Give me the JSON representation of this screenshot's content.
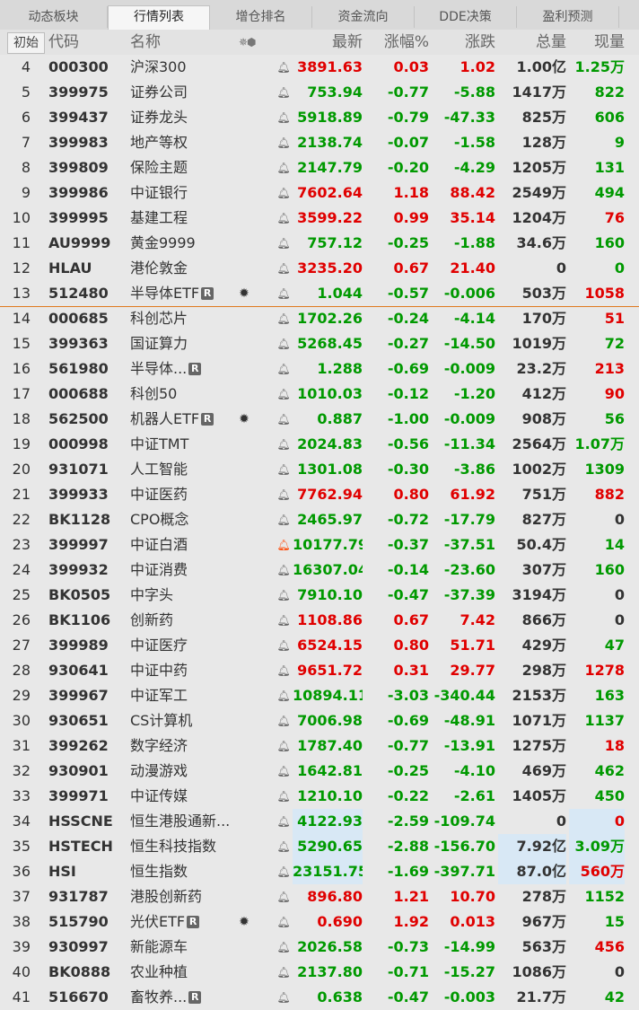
{
  "tabs": [
    {
      "label": "动态板块",
      "active": false
    },
    {
      "label": "行情列表",
      "active": true
    },
    {
      "label": "增仓排名",
      "active": false
    },
    {
      "label": "资金流向",
      "active": false
    },
    {
      "label": "DDE决策",
      "active": false
    },
    {
      "label": "盈利预测",
      "active": false
    }
  ],
  "header": {
    "init": "初始",
    "code": "代码",
    "name": "名称",
    "sort_icons": "✵⬢",
    "price": "最新",
    "pct": "涨幅%",
    "chg": "涨跌",
    "vol": "总量",
    "cur": "现量"
  },
  "colors": {
    "up": "#e00000",
    "down": "#009900",
    "separator": "#e07a20",
    "highlight": "#d8e8f5"
  },
  "rows": [
    {
      "idx": "4",
      "code": "000300",
      "name": "沪深300",
      "price": "3891.63",
      "pct": "0.03",
      "chg": "1.02",
      "vol": "1.00亿",
      "cur": "1.25万",
      "dir": "up",
      "cur_dir": "down"
    },
    {
      "idx": "5",
      "code": "399975",
      "name": "证券公司",
      "price": "753.94",
      "pct": "-0.77",
      "chg": "-5.88",
      "vol": "1417万",
      "cur": "822",
      "dir": "down",
      "cur_dir": "down"
    },
    {
      "idx": "6",
      "code": "399437",
      "name": "证券龙头",
      "price": "5918.89",
      "pct": "-0.79",
      "chg": "-47.33",
      "vol": "825万",
      "cur": "606",
      "dir": "down",
      "cur_dir": "down"
    },
    {
      "idx": "7",
      "code": "399983",
      "name": "地产等权",
      "price": "2138.74",
      "pct": "-0.07",
      "chg": "-1.58",
      "vol": "128万",
      "cur": "9",
      "dir": "down",
      "cur_dir": "down"
    },
    {
      "idx": "8",
      "code": "399809",
      "name": "保险主题",
      "price": "2147.79",
      "pct": "-0.20",
      "chg": "-4.29",
      "vol": "1205万",
      "cur": "131",
      "dir": "down",
      "cur_dir": "down"
    },
    {
      "idx": "9",
      "code": "399986",
      "name": "中证银行",
      "price": "7602.64",
      "pct": "1.18",
      "chg": "88.42",
      "vol": "2549万",
      "cur": "494",
      "dir": "up",
      "cur_dir": "down"
    },
    {
      "idx": "10",
      "code": "399995",
      "name": "基建工程",
      "price": "3599.22",
      "pct": "0.99",
      "chg": "35.14",
      "vol": "1204万",
      "cur": "76",
      "dir": "up",
      "cur_dir": "up"
    },
    {
      "idx": "11",
      "code": "AU9999",
      "name": "黄金9999",
      "price": "757.12",
      "pct": "-0.25",
      "chg": "-1.88",
      "vol": "34.6万",
      "cur": "160",
      "dir": "down",
      "cur_dir": "down"
    },
    {
      "idx": "12",
      "code": "HLAU",
      "name": "港伦敦金",
      "price": "3235.20",
      "pct": "0.67",
      "chg": "21.40",
      "vol": "0",
      "cur": "0",
      "dir": "up",
      "cur_dir": "down"
    },
    {
      "idx": "13",
      "code": "512480",
      "name": "半导体ETF",
      "badge": "R",
      "star": true,
      "price": "1.044",
      "pct": "-0.57",
      "chg": "-0.006",
      "vol": "503万",
      "cur": "1058",
      "dir": "down",
      "cur_dir": "up"
    },
    {
      "idx": "14",
      "code": "000685",
      "name": "科创芯片",
      "price": "1702.26",
      "pct": "-0.24",
      "chg": "-4.14",
      "vol": "170万",
      "cur": "51",
      "dir": "down",
      "cur_dir": "up"
    },
    {
      "idx": "15",
      "code": "399363",
      "name": "国证算力",
      "price": "5268.45",
      "pct": "-0.27",
      "chg": "-14.50",
      "vol": "1019万",
      "cur": "72",
      "dir": "down",
      "cur_dir": "down"
    },
    {
      "idx": "16",
      "code": "561980",
      "name": "半导体...",
      "badge": "R",
      "price": "1.288",
      "pct": "-0.69",
      "chg": "-0.009",
      "vol": "23.2万",
      "cur": "213",
      "dir": "down",
      "cur_dir": "up"
    },
    {
      "idx": "17",
      "code": "000688",
      "name": "科创50",
      "price": "1010.03",
      "pct": "-0.12",
      "chg": "-1.20",
      "vol": "412万",
      "cur": "90",
      "dir": "down",
      "cur_dir": "up"
    },
    {
      "idx": "18",
      "code": "562500",
      "name": "机器人ETF",
      "badge": "R",
      "star": true,
      "price": "0.887",
      "pct": "-1.00",
      "chg": "-0.009",
      "vol": "908万",
      "cur": "56",
      "dir": "down",
      "cur_dir": "down"
    },
    {
      "idx": "19",
      "code": "000998",
      "name": "中证TMT",
      "price": "2024.83",
      "pct": "-0.56",
      "chg": "-11.34",
      "vol": "2564万",
      "cur": "1.07万",
      "dir": "down",
      "cur_dir": "down"
    },
    {
      "idx": "20",
      "code": "931071",
      "name": "人工智能",
      "price": "1301.08",
      "pct": "-0.30",
      "chg": "-3.86",
      "vol": "1002万",
      "cur": "1309",
      "dir": "down",
      "cur_dir": "down"
    },
    {
      "idx": "21",
      "code": "399933",
      "name": "中证医药",
      "price": "7762.94",
      "pct": "0.80",
      "chg": "61.92",
      "vol": "751万",
      "cur": "882",
      "dir": "up",
      "cur_dir": "up"
    },
    {
      "idx": "22",
      "code": "BK1128",
      "name": "CPO概念",
      "price": "2465.97",
      "pct": "-0.72",
      "chg": "-17.79",
      "vol": "827万",
      "cur": "0",
      "dir": "down",
      "cur_dir": "neutral"
    },
    {
      "idx": "23",
      "code": "399997",
      "name": "中证白酒",
      "bell_alert": true,
      "price": "10177.79",
      "pct": "-0.37",
      "chg": "-37.51",
      "vol": "50.4万",
      "cur": "14",
      "dir": "down",
      "cur_dir": "down"
    },
    {
      "idx": "24",
      "code": "399932",
      "name": "中证消费",
      "price": "16307.04",
      "pct": "-0.14",
      "chg": "-23.60",
      "vol": "307万",
      "cur": "160",
      "dir": "down",
      "cur_dir": "down"
    },
    {
      "idx": "25",
      "code": "BK0505",
      "name": "中字头",
      "price": "7910.10",
      "pct": "-0.47",
      "chg": "-37.39",
      "vol": "3194万",
      "cur": "0",
      "dir": "down",
      "cur_dir": "neutral"
    },
    {
      "idx": "26",
      "code": "BK1106",
      "name": "创新药",
      "price": "1108.86",
      "pct": "0.67",
      "chg": "7.42",
      "vol": "866万",
      "cur": "0",
      "dir": "up",
      "cur_dir": "neutral"
    },
    {
      "idx": "27",
      "code": "399989",
      "name": "中证医疗",
      "price": "6524.15",
      "pct": "0.80",
      "chg": "51.71",
      "vol": "429万",
      "cur": "47",
      "dir": "up",
      "cur_dir": "down"
    },
    {
      "idx": "28",
      "code": "930641",
      "name": "中证中药",
      "price": "9651.72",
      "pct": "0.31",
      "chg": "29.77",
      "vol": "298万",
      "cur": "1278",
      "dir": "up",
      "cur_dir": "up"
    },
    {
      "idx": "29",
      "code": "399967",
      "name": "中证军工",
      "price": "10894.11",
      "pct": "-3.03",
      "chg": "-340.44",
      "vol": "2153万",
      "cur": "163",
      "dir": "down",
      "cur_dir": "down"
    },
    {
      "idx": "30",
      "code": "930651",
      "name": "CS计算机",
      "price": "7006.98",
      "pct": "-0.69",
      "chg": "-48.91",
      "vol": "1071万",
      "cur": "1137",
      "dir": "down",
      "cur_dir": "down"
    },
    {
      "idx": "31",
      "code": "399262",
      "name": "数字经济",
      "price": "1787.40",
      "pct": "-0.77",
      "chg": "-13.91",
      "vol": "1275万",
      "cur": "18",
      "dir": "down",
      "cur_dir": "up"
    },
    {
      "idx": "32",
      "code": "930901",
      "name": "动漫游戏",
      "price": "1642.81",
      "pct": "-0.25",
      "chg": "-4.10",
      "vol": "469万",
      "cur": "462",
      "dir": "down",
      "cur_dir": "down"
    },
    {
      "idx": "33",
      "code": "399971",
      "name": "中证传媒",
      "price": "1210.10",
      "pct": "-0.22",
      "chg": "-2.61",
      "vol": "1405万",
      "cur": "450",
      "dir": "down",
      "cur_dir": "down"
    },
    {
      "idx": "34",
      "code": "HSSCNE",
      "name": "恒生港股通新...",
      "price": "4122.93",
      "pct": "-2.59",
      "chg": "-109.74",
      "vol": "0",
      "cur": "0",
      "dir": "down",
      "cur_dir": "up",
      "hl_price": true,
      "hl_cur": true
    },
    {
      "idx": "35",
      "code": "HSTECH",
      "name": "恒生科技指数",
      "price": "5290.65",
      "pct": "-2.88",
      "chg": "-156.70",
      "vol": "7.92亿",
      "cur": "3.09万",
      "dir": "down",
      "cur_dir": "down",
      "hl_price": true,
      "hl_vol": true,
      "hl_cur": true
    },
    {
      "idx": "36",
      "code": "HSI",
      "name": "恒生指数",
      "price": "23151.75",
      "pct": "-1.69",
      "chg": "-397.71",
      "vol": "87.0亿",
      "cur": "560万",
      "dir": "down",
      "cur_dir": "up",
      "hl_price": true,
      "hl_vol": true,
      "hl_cur": true
    },
    {
      "idx": "37",
      "code": "931787",
      "name": "港股创新药",
      "price": "896.80",
      "pct": "1.21",
      "chg": "10.70",
      "vol": "278万",
      "cur": "1152",
      "dir": "up",
      "cur_dir": "down"
    },
    {
      "idx": "38",
      "code": "515790",
      "name": "光伏ETF",
      "badge": "R",
      "star": true,
      "price": "0.690",
      "pct": "1.92",
      "chg": "0.013",
      "vol": "967万",
      "cur": "15",
      "dir": "up",
      "cur_dir": "down"
    },
    {
      "idx": "39",
      "code": "930997",
      "name": "新能源车",
      "price": "2026.58",
      "pct": "-0.73",
      "chg": "-14.99",
      "vol": "563万",
      "cur": "456",
      "dir": "down",
      "cur_dir": "up"
    },
    {
      "idx": "40",
      "code": "BK0888",
      "name": "农业种植",
      "price": "2137.80",
      "pct": "-0.71",
      "chg": "-15.27",
      "vol": "1086万",
      "cur": "0",
      "dir": "down",
      "cur_dir": "neutral"
    },
    {
      "idx": "41",
      "code": "516670",
      "name": "畜牧养...",
      "badge": "R",
      "price": "0.638",
      "pct": "-0.47",
      "chg": "-0.003",
      "vol": "21.7万",
      "cur": "42",
      "dir": "down",
      "cur_dir": "down"
    }
  ]
}
